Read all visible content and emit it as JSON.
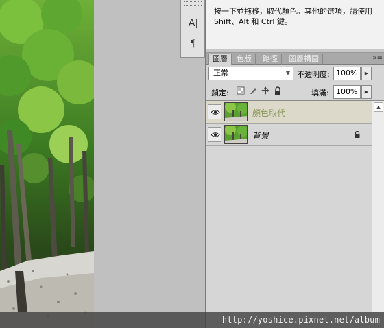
{
  "tool_strip": {
    "items": [
      {
        "name": "character-panel",
        "glyph": "A|"
      },
      {
        "name": "paragraph-panel",
        "glyph": "¶"
      }
    ]
  },
  "info_panel": {
    "text": "按一下並拖移，取代顏色。其他的選項，請使用 Shift、Alt 和 Ctrl 鍵。"
  },
  "tabs": [
    {
      "label": "圖層",
      "active": true
    },
    {
      "label": "色版",
      "active": false
    },
    {
      "label": "路徑",
      "active": false
    },
    {
      "label": "圖層構圖",
      "active": false
    }
  ],
  "panel_menu_glyph": "»≡",
  "layers_panel": {
    "blend_mode": "正常",
    "opacity_label": "不透明度:",
    "opacity_value": "100%",
    "lock_label": "鎖定:",
    "fill_label": "填滿:",
    "fill_value": "100%",
    "layers": [
      {
        "name": "顏色取代",
        "selected": true,
        "visible": true,
        "italic": false,
        "locked": false
      },
      {
        "name": "背景",
        "selected": false,
        "visible": true,
        "italic": true,
        "locked": true
      }
    ]
  },
  "watermark": "http://yoshice.pixnet.net/album",
  "colors": {
    "panel_bg": "#d6d6d6",
    "selected_layer_bg": "#dcd8ca",
    "selected_layer_text": "#8a9a5a",
    "tab_bar_bg": "#a9a9a9",
    "canvas_bg": "#c0c0c0"
  }
}
